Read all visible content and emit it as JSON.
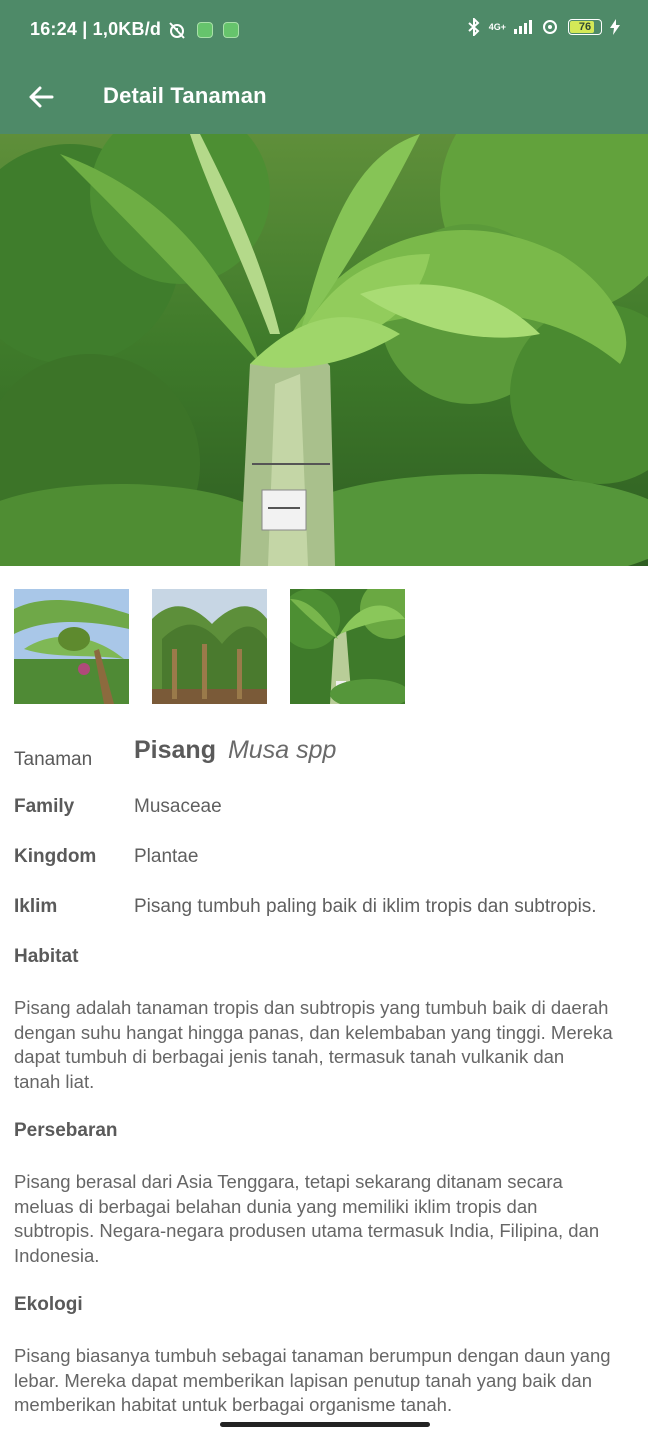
{
  "status_bar": {
    "time_speed": "16:24 | 1,0KB/d",
    "network": "4G+",
    "battery": "76",
    "battery_level": 0.76
  },
  "app_bar": {
    "title": "Detail Tanaman",
    "back_icon": "arrow-left-icon"
  },
  "hero": {
    "description_icon": "banana-plant-photo"
  },
  "thumbnails": [
    "banana-fruit-photo",
    "banana-grove-photo",
    "banana-trunk-photo"
  ],
  "details": {
    "plant": {
      "label": "Tanaman",
      "name": "Pisang",
      "latin": "Musa spp"
    },
    "family": {
      "label": "Family",
      "value": "Musaceae"
    },
    "kingdom": {
      "label": "Kingdom",
      "value": "Plantae"
    },
    "climate": {
      "label": "Iklim",
      "value": "Pisang tumbuh paling baik di iklim tropis dan subtropis."
    }
  },
  "sections": {
    "habitat": {
      "title": "Habitat",
      "lines": [
        "Pisang adalah tanaman tropis dan subtropis yang tumbuh baik di daerah",
        "dengan suhu hangat hingga panas, dan kelembaban yang tinggi. Mereka",
        "dapat tumbuh di berbagai jenis tanah, termasuk tanah vulkanik dan",
        "tanah liat."
      ]
    },
    "distribution": {
      "title": "Persebaran",
      "lines": [
        "Pisang berasal dari Asia Tenggara, tetapi sekarang ditanam secara",
        "meluas di berbagai belahan dunia yang memiliki iklim tropis dan",
        "subtropis. Negara-negara produsen utama termasuk India, Filipina, dan",
        "Indonesia."
      ]
    },
    "ecology": {
      "title": "Ekologi",
      "lines": [
        "Pisang biasanya tumbuh sebagai tanaman berumpun dengan daun yang",
        "lebar. Mereka dapat memberikan lapisan penutup tanah yang baik dan",
        "memberikan habitat untuk berbagai organisme tanah."
      ]
    }
  },
  "colors": {
    "app_bar": "#4e8a68",
    "text": "#5f5f5f"
  }
}
